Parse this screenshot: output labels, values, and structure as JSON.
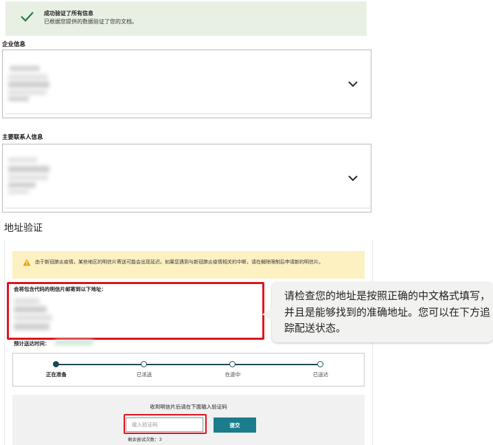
{
  "success": {
    "title": "成功验证了所有信息",
    "subtitle": "已根据您提供的数据验证了您的文档。",
    "icon": "check-icon",
    "accent_color": "#1f7a3c"
  },
  "business_info": {
    "label": "企业信息",
    "expand_icon": "chevron-down-icon"
  },
  "contact_info": {
    "label": "主要联系人信息",
    "expand_icon": "chevron-down-icon"
  },
  "address_verification": {
    "heading": "地址验证",
    "warning": {
      "icon": "warning-icon",
      "text": "由于新冠肺炎疫情，某些地区的明信片寄送可能会出现延迟。如果您遇到与新冠肺炎疫情相关的中断，请在解除限制后申请新的明信片。"
    },
    "mail_label": "会将包含代码的明信片邮寄到以下地址：",
    "eta_label": "预计送达时间：",
    "steps": [
      {
        "label": "正在准备",
        "active": true
      },
      {
        "label": "已派送",
        "active": false
      },
      {
        "label": "在途中",
        "active": false
      },
      {
        "label": "已送达",
        "active": false
      }
    ],
    "verify": {
      "title": "收到明信片后请在下面输入验证码",
      "input_placeholder": "输入验证码",
      "input_value": "",
      "submit_label": "提交",
      "attempts_text": "剩余尝试次数：3",
      "submit_color": "#1b7c8b"
    }
  },
  "callout": {
    "text": "请检查您的地址是按照正确的中文格式填写，并且是能够找到的准确地址。您可以在下方追踪配送状态。"
  },
  "highlight_color": "#e0101a"
}
